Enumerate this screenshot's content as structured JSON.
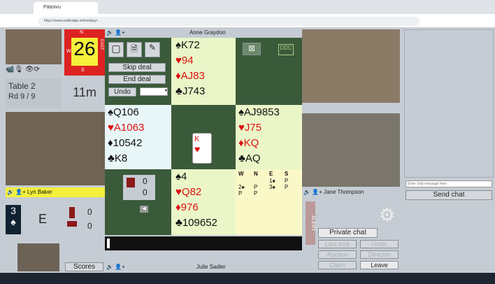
{
  "browser": {
    "tab_title": "Pääsivu",
    "url": "https://www.realbridge.online/play/…"
  },
  "score": {
    "deal": "26",
    "n": "N",
    "s": "S",
    "w": "W",
    "e": "EAST"
  },
  "toolbar": {
    "skip": "Skip deal",
    "end": "End deal",
    "undo": "Undo"
  },
  "info": {
    "table": "Table 2",
    "round": "Rd 9 / 9",
    "time": "11m"
  },
  "players": {
    "north": "Anne Graydon",
    "west": "Lyn Baker",
    "east": "Jane Thompson",
    "south": "Julie Sadler"
  },
  "north": {
    "s": "♠K72",
    "h": "♥94",
    "d": "♦AJ83",
    "c": "♣J743"
  },
  "west": {
    "s": "♠Q106",
    "h": "♥A1063",
    "d": "♦10542",
    "c": "♣K8"
  },
  "east": {
    "s": "♠AJ9853",
    "h": "♥J75",
    "d": "♦KQ",
    "c": "♣AQ"
  },
  "south": {
    "s": "♠4",
    "h": "♥Q82",
    "d": "♦976",
    "c": "♣109652"
  },
  "card": {
    "rank": "K",
    "suit": "♥"
  },
  "tricks": {
    "ns": "0",
    "ew": "0",
    "ns2": "0",
    "ew2": "0"
  },
  "bidding": {
    "headers": [
      "W",
      "N",
      "E",
      "S"
    ],
    "r1": [
      "",
      "",
      "1♠",
      "P"
    ],
    "r2": [
      "2♠",
      "P",
      "3♠",
      "P"
    ],
    "r3": [
      "P",
      "P",
      "",
      ""
    ]
  },
  "contract": {
    "level": "3",
    "suit": "♠",
    "declarer": "E"
  },
  "alert": "ALERT",
  "chat": {
    "placeholder": "Enter chat message here",
    "send": "Send chat"
  },
  "actions": {
    "private": "Private chat",
    "last": "Last trick",
    "undo": "Undo",
    "auction": "Auction",
    "director": "Director",
    "claim": "Claim",
    "leave": "Leave",
    "scores": "Scores"
  }
}
